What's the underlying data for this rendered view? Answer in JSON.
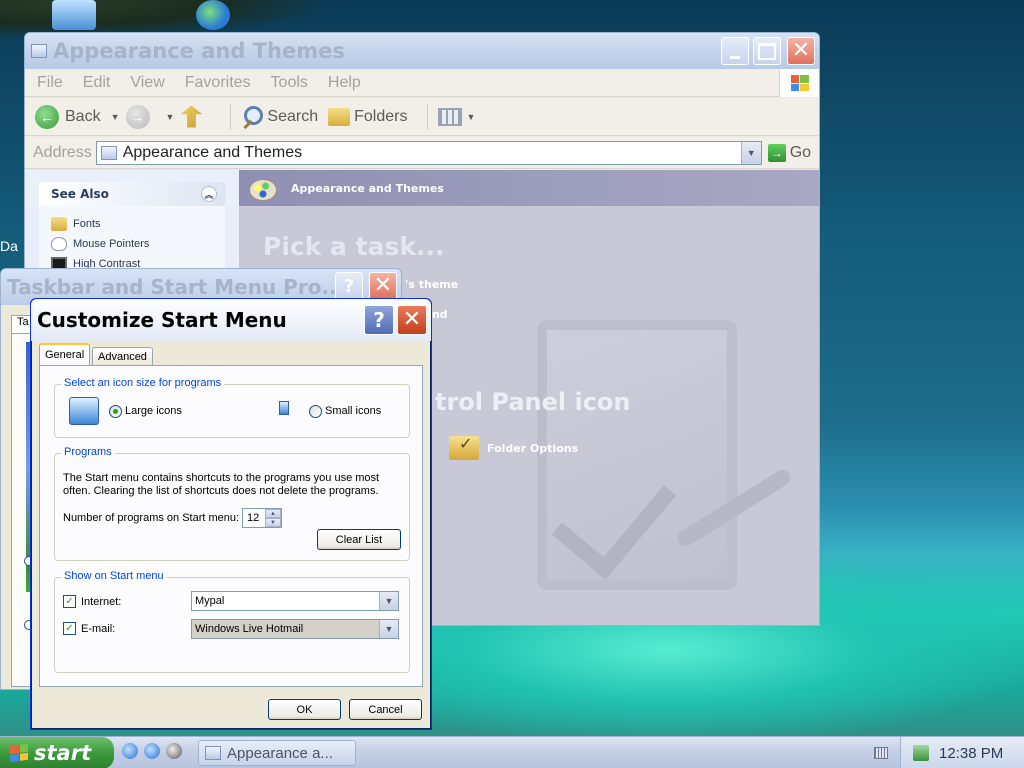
{
  "desktop": {
    "partial_label": "Da"
  },
  "explorer": {
    "title": "Appearance and Themes",
    "menu": [
      "File",
      "Edit",
      "View",
      "Favorites",
      "Tools",
      "Help"
    ],
    "toolbar": {
      "back_label": "Back",
      "search_label": "Search",
      "folders_label": "Folders"
    },
    "address": {
      "label": "Address",
      "value": "Appearance and Themes",
      "go_label": "Go"
    },
    "see_also": {
      "title": "See Also",
      "items": [
        "Fonts",
        "Mouse Pointers",
        "High Contrast"
      ]
    },
    "main": {
      "banner_title": "Appearance and Themes",
      "pick_task": "Pick a task...",
      "task_fragment_1": "'s theme",
      "task_fragment_2": "round",
      "cp_heading_fragment": "trol Panel icon",
      "folder_options": "Folder Options"
    }
  },
  "taskbar_props": {
    "title": "Taskbar and Start Menu Pro...",
    "tab_fragment": "Ta"
  },
  "customize": {
    "title": "Customize Start Menu",
    "tabs": [
      "General",
      "Advanced"
    ],
    "icon_size": {
      "legend": "Select an icon size for programs",
      "large_label": "Large icons",
      "small_label": "Small icons",
      "selected": "large"
    },
    "programs": {
      "legend": "Programs",
      "description": "The Start menu contains shortcuts to the programs you use most often. Clearing the list of shortcuts does not delete the programs.",
      "count_label": "Number of programs on Start menu:",
      "count_value": "12",
      "clear_label": "Clear List"
    },
    "show": {
      "legend": "Show on Start menu",
      "internet_label": "Internet:",
      "internet_value": "Mypal",
      "internet_checked": true,
      "email_label": "E-mail:",
      "email_value": "Windows Live Hotmail",
      "email_checked": true
    },
    "ok_label": "OK",
    "cancel_label": "Cancel"
  },
  "taskbar": {
    "start_label": "start",
    "task_label": "Appearance a...",
    "clock": "12:38 PM"
  },
  "colors": {
    "xp_blue": "#0046d5",
    "start_green": "#3c9a3c",
    "close_red": "#c23e1c"
  }
}
